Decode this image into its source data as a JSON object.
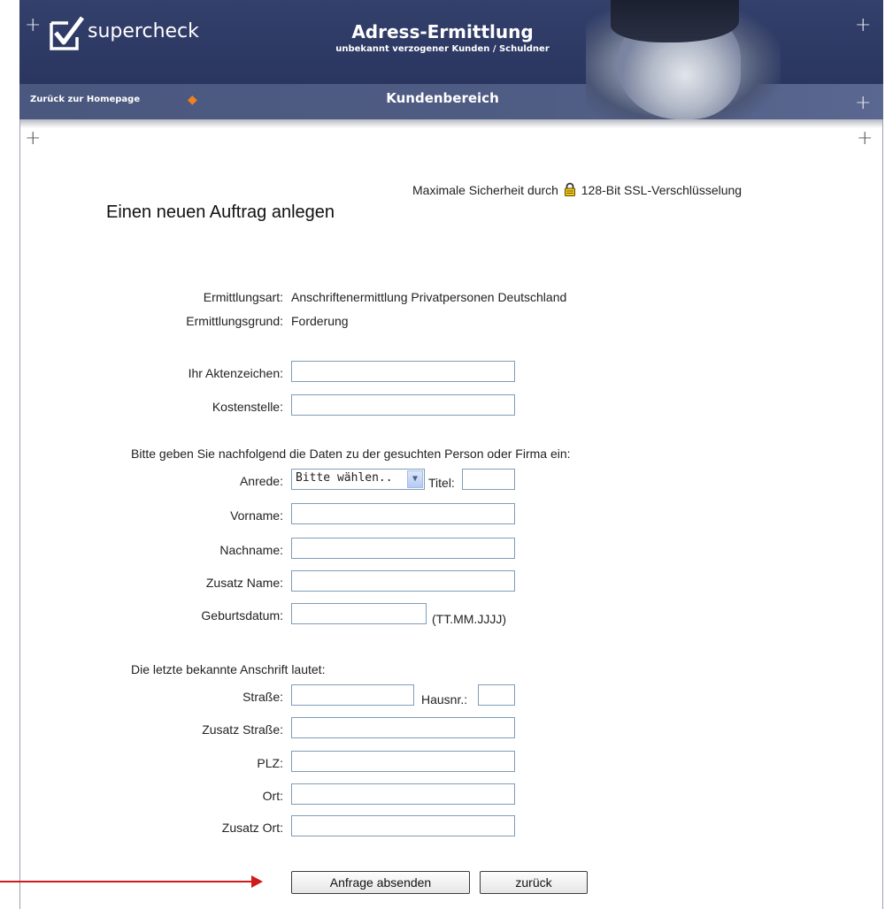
{
  "header": {
    "logo_text": "supercheck",
    "title": "Adress-Ermittlung",
    "subtitle": "unbekannt verzogener Kunden / Schuldner",
    "back_link": "Zurück zur Homepage",
    "section_title": "Kundenbereich"
  },
  "ssl": {
    "prefix": "Maximale Sicherheit durch",
    "suffix": "128-Bit SSL-Verschlüsselung",
    "icon": "lock-icon"
  },
  "page_title": "Einen neuen Auftrag anlegen",
  "info": {
    "ermittlungsart_label": "Ermittlungsart:",
    "ermittlungsart_value": "Anschriftenermittlung Privatpersonen Deutschland",
    "ermittlungsgrund_label": "Ermittlungsgrund:",
    "ermittlungsgrund_value": "Forderung"
  },
  "order": {
    "aktenzeichen_label": "Ihr Aktenzeichen:",
    "aktenzeichen_value": "",
    "kostenstelle_label": "Kostenstelle:",
    "kostenstelle_value": ""
  },
  "person": {
    "intro": "Bitte geben Sie nachfolgend die Daten zu der gesuchten Person oder Firma ein:",
    "anrede_label": "Anrede:",
    "anrede_selected": "Bitte wählen..",
    "titel_label": "Titel:",
    "vorname_label": "Vorname:",
    "nachname_label": "Nachname:",
    "zusatz_name_label": "Zusatz Name:",
    "geburtsdatum_label": "Geburtsdatum:",
    "geburtsdatum_hint": "(TT.MM.JJJJ)"
  },
  "address": {
    "intro": "Die letzte bekannte Anschrift lautet:",
    "strasse_label": "Straße:",
    "hausnr_label": "Hausnr.:",
    "zusatz_strasse_label": "Zusatz Straße:",
    "plz_label": "PLZ:",
    "ort_label": "Ort:",
    "zusatz_ort_label": "Zusatz Ort:"
  },
  "buttons": {
    "submit": "Anfrage absenden",
    "back": "zurück"
  },
  "colors": {
    "header_bg": "#2e3a63",
    "nav_bg": "#4f5c84",
    "arrow_red": "#d11a1a",
    "nav_arrow": "#f08020"
  }
}
